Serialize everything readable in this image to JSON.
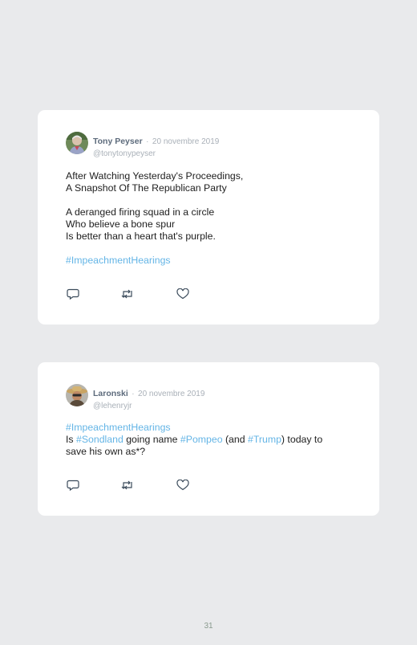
{
  "tweets": [
    {
      "name": "Tony Peyser",
      "separator": "·",
      "date": "20 novembre 2019",
      "handle": "@tonytonypeyser",
      "p1": [
        "After Watching Yesterday's Proceedings,",
        "A Snapshot Of The Republican Party"
      ],
      "p2": [
        "A deranged firing squad in a circle",
        "Who believe a bone spur",
        "Is better than a heart that's purple."
      ],
      "hashtag": "#ImpeachmentHearings"
    },
    {
      "name": "Laronski",
      "separator": "·",
      "date": "20 novembre 2019",
      "handle": "@lehenryjr",
      "hashtag": "#ImpeachmentHearings",
      "l2": [
        "Is ",
        "#Sondland",
        " going name ",
        "#Pompeo",
        " (and ",
        "#Trump",
        ") today to"
      ],
      "l3": "save his own as*?"
    }
  ],
  "icons": [
    "reply-icon",
    "retweet-icon",
    "like-icon"
  ],
  "colors": {
    "hashtag": "#64b5e6",
    "name": "#5d6b7c",
    "muted": "#a9b0b8",
    "background": "#e9eaec"
  },
  "page_number": "31"
}
